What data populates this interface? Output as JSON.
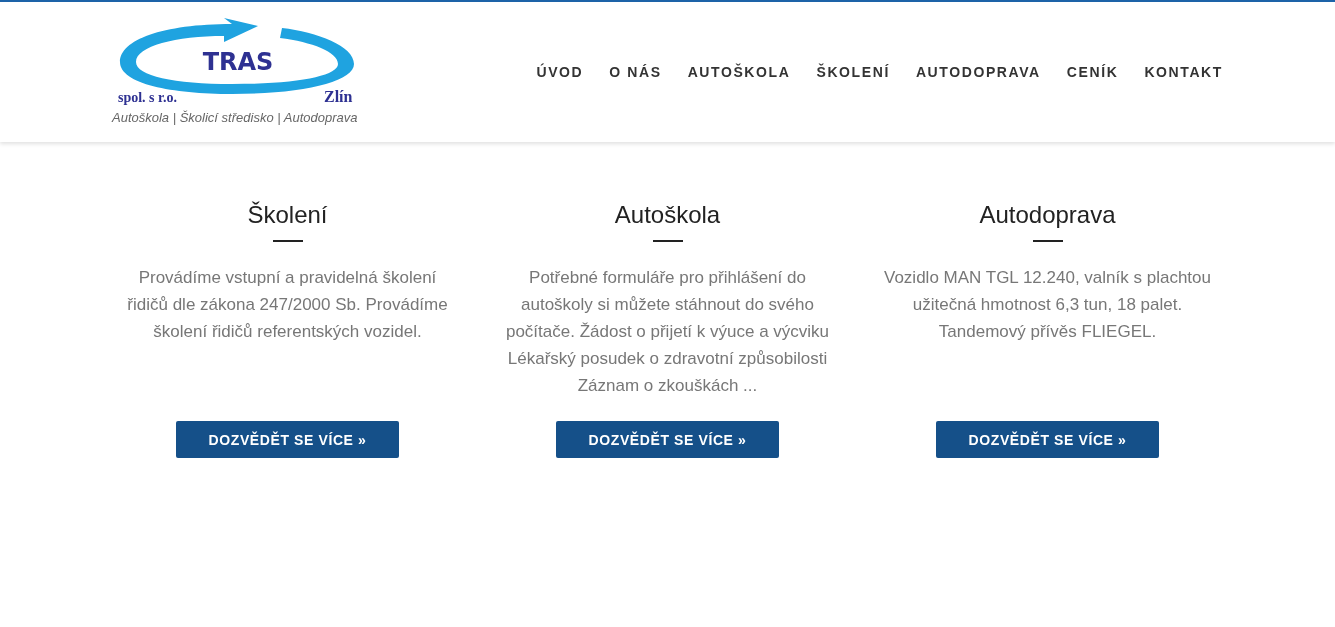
{
  "logo": {
    "name": "TRAS",
    "left_caption": "spol. s r.o.",
    "right_caption": "Zlín",
    "tagline": "Autoškola | Školicí středisko | Autodoprava"
  },
  "nav": [
    {
      "label": "ÚVOD"
    },
    {
      "label": "O NÁS"
    },
    {
      "label": "AUTOŠKOLA"
    },
    {
      "label": "ŠKOLENÍ"
    },
    {
      "label": "AUTODOPRAVA"
    },
    {
      "label": "CENÍK"
    },
    {
      "label": "KONTAKT"
    }
  ],
  "features": [
    {
      "title": "Školení",
      "text": "Provádíme vstupní a pravidelná školení řidičů dle zákona 247/2000 Sb. Provádíme školení řidičů referentských vozidel.",
      "button": "DOZVĚDĚT SE VÍCE »"
    },
    {
      "title": "Autoškola",
      "text": "Potřebné formuláře pro přihlášení do autoškoly si můžete stáhnout do svého počítače. Žádost o přijetí k výuce a výcviku Lékařský posudek o zdravotní způsobilosti Záznam o zkouškách ...",
      "button": "DOZVĚDĚT SE VÍCE »"
    },
    {
      "title": "Autodoprava",
      "text": "Vozidlo MAN TGL 12.240, valník s plachtou užitečná hmotnost 6,3 tun, 18 palet. Tandemový přívěs FLIEGEL.",
      "button": "DOZVĚDĚT SE VÍCE »"
    }
  ]
}
